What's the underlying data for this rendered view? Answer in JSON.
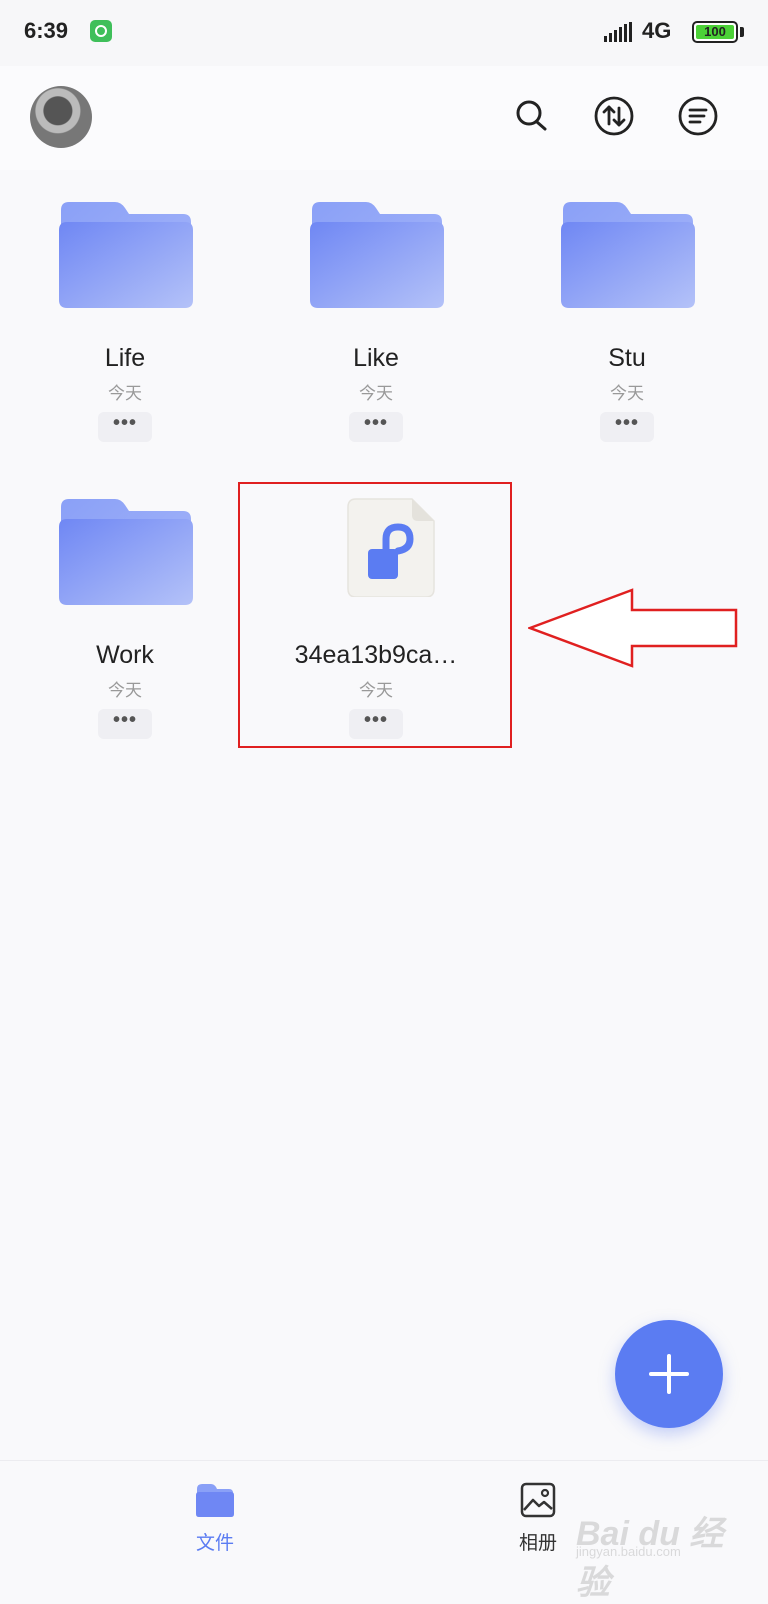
{
  "status_bar": {
    "time": "6:39",
    "network": "4G",
    "battery": "100",
    "app_icon": "cat-face-icon",
    "icons": [
      "signal-icon",
      "battery-icon"
    ]
  },
  "header": {
    "avatar": "user-avatar",
    "actions": [
      "search-icon",
      "transfer-icon",
      "sort-menu-icon"
    ]
  },
  "colors": {
    "accent": "#5b7cf2",
    "folder": "#7d93f5",
    "highlight": "#e02020"
  },
  "items": [
    {
      "name": "Life",
      "date": "今天",
      "more": "•••",
      "type": "folder"
    },
    {
      "name": "Like",
      "date": "今天",
      "more": "•••",
      "type": "folder"
    },
    {
      "name": "Stu",
      "date": "今天",
      "more": "•••",
      "type": "folder"
    },
    {
      "name": "Work",
      "date": "今天",
      "more": "•••",
      "type": "folder"
    },
    {
      "name": "34ea13b9ca…",
      "date": "今天",
      "more": "•••",
      "type": "locked-file"
    }
  ],
  "fab": {
    "icon": "plus-icon"
  },
  "tabs": [
    {
      "label": "文件",
      "icon": "folder-icon",
      "active": true
    },
    {
      "label": "相册",
      "icon": "album-icon",
      "active": false
    }
  ],
  "watermark": {
    "text": "Bai du 经验",
    "url": "jingyan.baidu.com"
  }
}
